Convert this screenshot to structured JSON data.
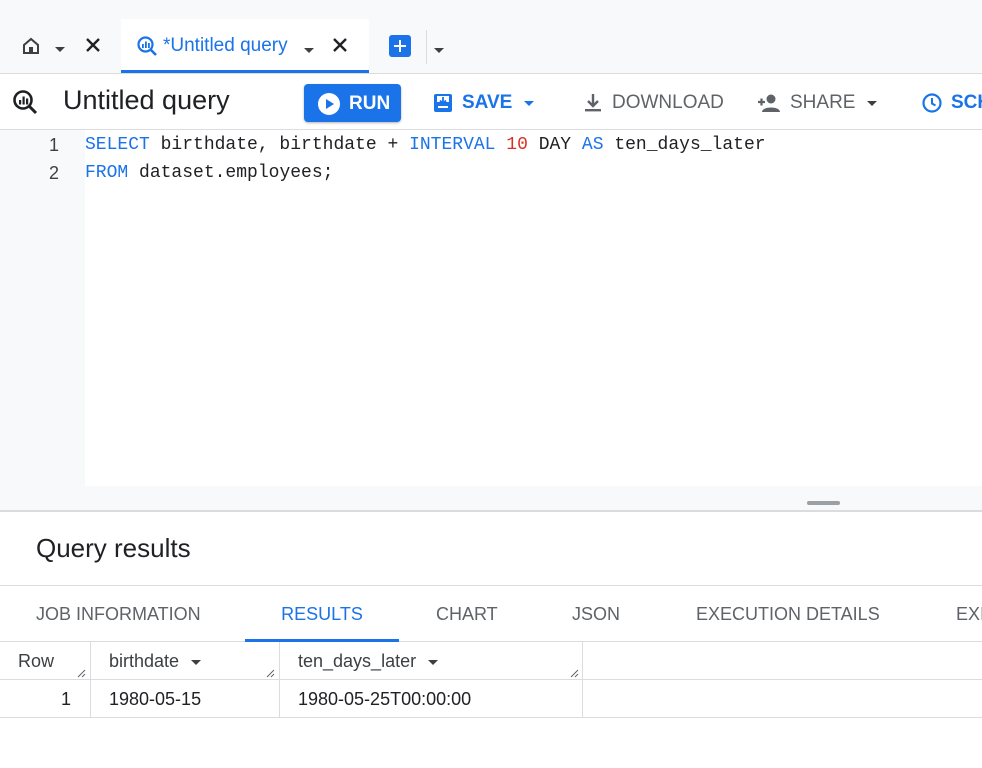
{
  "tabs": {
    "home_icon": "home-icon",
    "query_tab_label": "*Untitled query",
    "query_tab_icon": "query-icon"
  },
  "toolbar": {
    "title": "Untitled query",
    "run_label": "RUN",
    "save_label": "SAVE",
    "download_label": "DOWNLOAD",
    "share_label": "SHARE",
    "schedule_label": "SCH"
  },
  "editor": {
    "line_numbers": [
      "1",
      "2"
    ],
    "lines": [
      {
        "tokens": [
          {
            "t": "SELECT",
            "c": "kw"
          },
          {
            "t": " birthdate, birthdate + ",
            "c": ""
          },
          {
            "t": "INTERVAL",
            "c": "kw"
          },
          {
            "t": " ",
            "c": ""
          },
          {
            "t": "10",
            "c": "num"
          },
          {
            "t": " DAY ",
            "c": ""
          },
          {
            "t": "AS",
            "c": "kw"
          },
          {
            "t": " ten_days_later",
            "c": ""
          }
        ]
      },
      {
        "tokens": [
          {
            "t": "FROM",
            "c": "kw"
          },
          {
            "t": " dataset.employees;",
            "c": ""
          }
        ]
      }
    ]
  },
  "results": {
    "title": "Query results",
    "tabs": [
      "JOB INFORMATION",
      "RESULTS",
      "CHART",
      "JSON",
      "EXECUTION DETAILS",
      "EXI"
    ],
    "active_tab": "RESULTS",
    "columns": [
      "Row",
      "birthdate",
      "ten_days_later"
    ],
    "rows": [
      {
        "row": "1",
        "birthdate": "1980-05-15",
        "ten_days_later": "1980-05-25T00:00:00"
      }
    ]
  },
  "colors": {
    "accent": "#1a73e8",
    "number": "#d93025"
  }
}
